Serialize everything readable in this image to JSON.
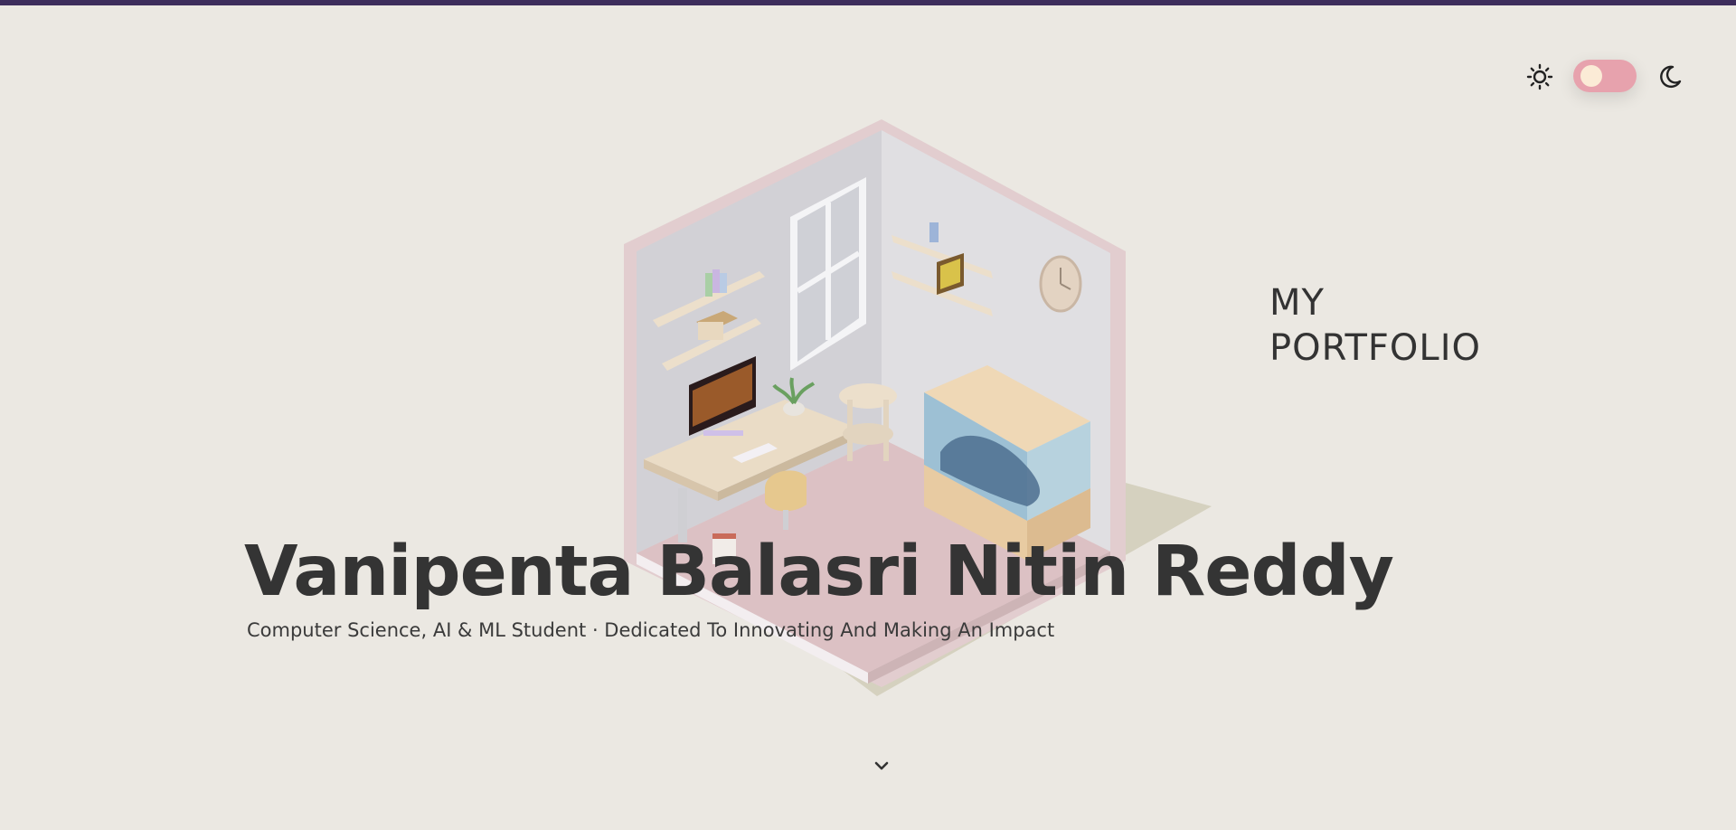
{
  "header": {
    "theme_toggle": {
      "sun_icon": "sun-icon",
      "moon_icon": "moon-icon",
      "mode": "light",
      "track_color": "#e7a2ad",
      "knob_color": "#fbebd6"
    }
  },
  "hero": {
    "name": "Vanipenta Balasri Nitin Reddy",
    "tagline": "Computer Science, AI & ML Student · Dedicated To Innovating And Making An Impact",
    "portfolio_label": "MY\nPORTFOLIO",
    "scroll_icon": "chevron-down-icon"
  },
  "colors": {
    "background": "#ebe8e2",
    "top_bar": "#3d2d5c",
    "text": "#343434"
  }
}
